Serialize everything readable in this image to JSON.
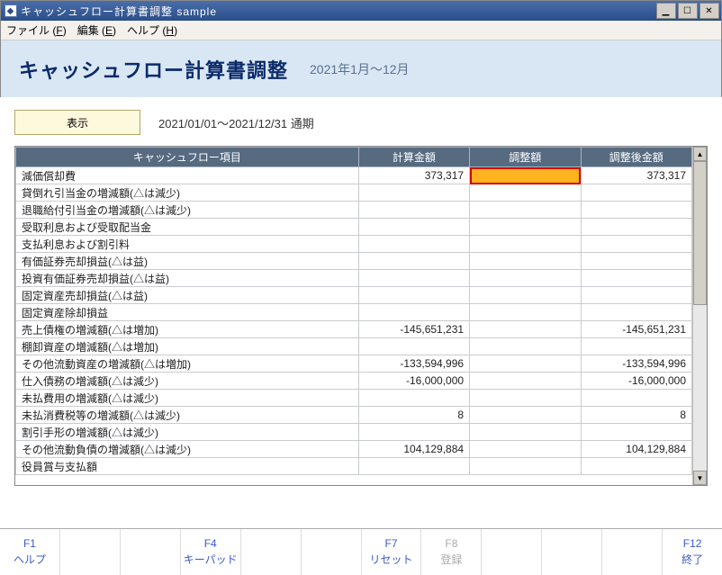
{
  "window": {
    "title": "キャッシュフロー計算書調整 sample",
    "icon_glyph": "◆"
  },
  "menu": {
    "file": "ファイル (",
    "file_u": "F",
    "file2": ")",
    "edit": "編集 (",
    "edit_u": "E",
    "edit2": ")",
    "help": "ヘルプ (",
    "help_u": "H",
    "help2": ")"
  },
  "header": {
    "title": "キャッシュフロー計算書調整",
    "period": "2021年1月～12月"
  },
  "toolbar": {
    "show_label": "表示",
    "date_range": "2021/01/01～2021/12/31 通期"
  },
  "table": {
    "columns": {
      "item": "キャッシュフロー項目",
      "calc": "計算金額",
      "adj": "調整額",
      "after": "調整後金額"
    },
    "rows": [
      {
        "item": "減価償却費",
        "calc": "373,317",
        "adj": "",
        "after": "373,317",
        "adj_highlight": true
      },
      {
        "item": "貸倒れ引当金の増減額(△は減少)",
        "calc": "",
        "adj": "",
        "after": ""
      },
      {
        "item": "退職給付引当金の増減額(△は減少)",
        "calc": "",
        "adj": "",
        "after": ""
      },
      {
        "item": "受取利息および受取配当金",
        "calc": "",
        "adj": "",
        "after": ""
      },
      {
        "item": "支払利息および割引料",
        "calc": "",
        "adj": "",
        "after": ""
      },
      {
        "item": "有価証券売却損益(△は益)",
        "calc": "",
        "adj": "",
        "after": ""
      },
      {
        "item": "投資有価証券売却損益(△は益)",
        "calc": "",
        "adj": "",
        "after": ""
      },
      {
        "item": "固定資産売却損益(△は益)",
        "calc": "",
        "adj": "",
        "after": ""
      },
      {
        "item": "固定資産除却損益",
        "calc": "",
        "adj": "",
        "after": ""
      },
      {
        "item": "売上債権の増減額(△は増加)",
        "calc": "-145,651,231",
        "adj": "",
        "after": "-145,651,231"
      },
      {
        "item": "棚卸資産の増減額(△は増加)",
        "calc": "",
        "adj": "",
        "after": ""
      },
      {
        "item": "その他流動資産の増減額(△は増加)",
        "calc": "-133,594,996",
        "adj": "",
        "after": "-133,594,996"
      },
      {
        "item": "仕入債務の増減額(△は減少)",
        "calc": "-16,000,000",
        "adj": "",
        "after": "-16,000,000"
      },
      {
        "item": "未払費用の増減額(△は減少)",
        "calc": "",
        "adj": "",
        "after": ""
      },
      {
        "item": "未払消費税等の増減額(△は減少)",
        "calc": "8",
        "adj": "",
        "after": "8"
      },
      {
        "item": "割引手形の増減額(△は減少)",
        "calc": "",
        "adj": "",
        "after": ""
      },
      {
        "item": "その他流動負債の増減額(△は減少)",
        "calc": "104,129,884",
        "adj": "",
        "after": "104,129,884"
      },
      {
        "item": "役員賞与支払額",
        "calc": "",
        "adj": "",
        "after": ""
      }
    ]
  },
  "footer": {
    "f1_key": "F1",
    "f1_label": "ヘルプ",
    "f4_key": "F4",
    "f4_label": "キーパッド",
    "f7_key": "F7",
    "f7_label": "リセット",
    "f8_key": "F8",
    "f8_label": "登録",
    "f12_key": "F12",
    "f12_label": "終了"
  }
}
